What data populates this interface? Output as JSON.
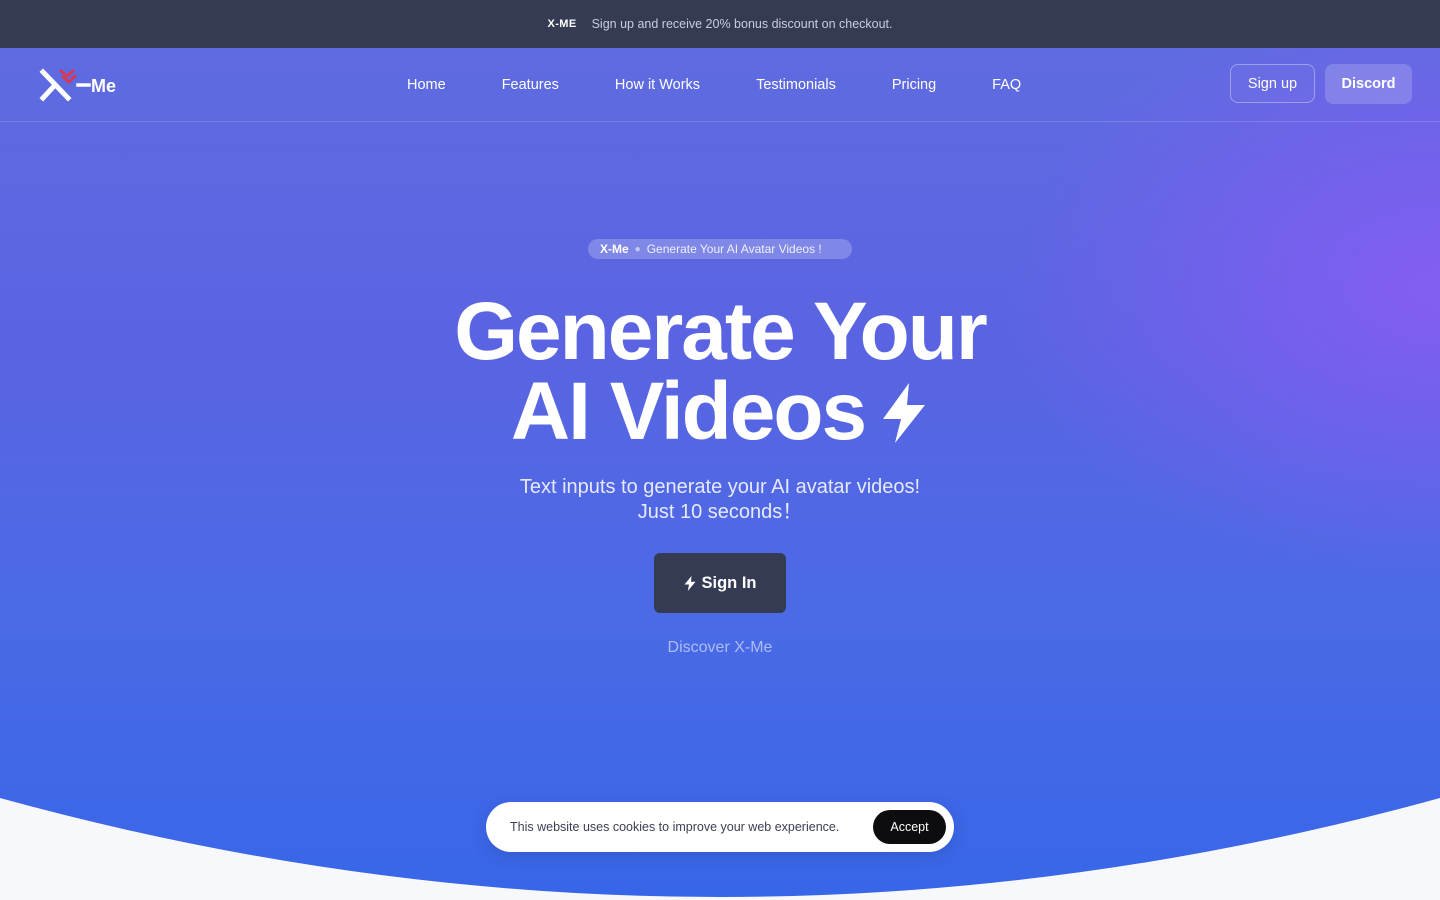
{
  "announcement": {
    "tag": "X-ME",
    "text": "Sign up and receive 20% bonus discount on checkout."
  },
  "nav": {
    "logo_text": "X-Me",
    "links": [
      "Home",
      "Features",
      "How it Works",
      "Testimonials",
      "Pricing",
      "FAQ"
    ],
    "signup_label": "Sign up",
    "discord_label": "Discord"
  },
  "hero": {
    "pill_brand": "X-Me",
    "pill_text": "Generate Your AI Avatar Videos !",
    "headline_line1": "Generate Your",
    "headline_line2": "AI Videos",
    "subtitle_line1": "Text inputs to generate your AI avatar videos!",
    "subtitle_line2": "Just 10 seconds！",
    "signin_label": "Sign In",
    "discover_label": "Discover X-Me"
  },
  "cookie": {
    "text": "This website uses cookies to improve your web experience.",
    "accept_label": "Accept"
  },
  "colors": {
    "announcement_bg": "#343b53",
    "hero_gradient_top": "#5f6be0",
    "hero_gradient_bottom": "#3866e8",
    "accent_violet": "#8b5cf6",
    "logo_accent": "#e0344a",
    "signin_bg": "#343b53"
  },
  "icons": {
    "headline_icon": "lightning-bolt-icon",
    "signin_icon": "lightning-bolt-icon"
  }
}
